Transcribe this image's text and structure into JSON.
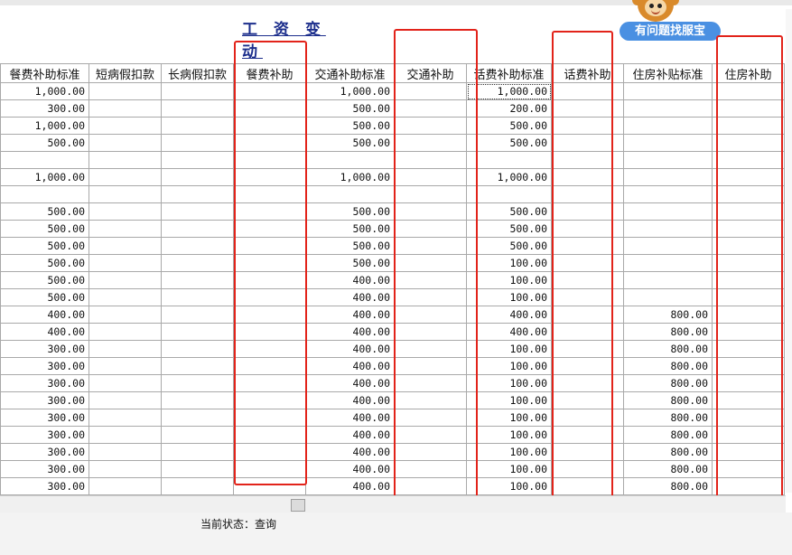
{
  "title": "工 资 变 动",
  "help_button": "有问题找服宝",
  "colors": {
    "title": "#1c2e8c",
    "highlight": "#e2231a",
    "help": "#4a90e2"
  },
  "columns": [
    "餐费补助标准",
    "短病假扣款",
    "长病假扣款",
    "餐费补助",
    "交通补助标准",
    "交通补助",
    "话费补助标准",
    "话费补助",
    "住房补贴标准",
    "住房补助"
  ],
  "rows": [
    [
      "1,000.00",
      "",
      "",
      "",
      "1,000.00",
      "",
      "1,000.00",
      "",
      "",
      ""
    ],
    [
      "300.00",
      "",
      "",
      "",
      "500.00",
      "",
      "200.00",
      "",
      "",
      ""
    ],
    [
      "1,000.00",
      "",
      "",
      "",
      "500.00",
      "",
      "500.00",
      "",
      "",
      ""
    ],
    [
      "500.00",
      "",
      "",
      "",
      "500.00",
      "",
      "500.00",
      "",
      "",
      ""
    ],
    [
      "",
      "",
      "",
      "",
      "",
      "",
      "",
      "",
      "",
      ""
    ],
    [
      "1,000.00",
      "",
      "",
      "",
      "1,000.00",
      "",
      "1,000.00",
      "",
      "",
      ""
    ],
    [
      "",
      "",
      "",
      "",
      "",
      "",
      "",
      "",
      "",
      ""
    ],
    [
      "500.00",
      "",
      "",
      "",
      "500.00",
      "",
      "500.00",
      "",
      "",
      ""
    ],
    [
      "500.00",
      "",
      "",
      "",
      "500.00",
      "",
      "500.00",
      "",
      "",
      ""
    ],
    [
      "500.00",
      "",
      "",
      "",
      "500.00",
      "",
      "500.00",
      "",
      "",
      ""
    ],
    [
      "500.00",
      "",
      "",
      "",
      "500.00",
      "",
      "100.00",
      "",
      "",
      ""
    ],
    [
      "500.00",
      "",
      "",
      "",
      "400.00",
      "",
      "100.00",
      "",
      "",
      ""
    ],
    [
      "500.00",
      "",
      "",
      "",
      "400.00",
      "",
      "100.00",
      "",
      "",
      ""
    ],
    [
      "400.00",
      "",
      "",
      "",
      "400.00",
      "",
      "400.00",
      "",
      "800.00",
      ""
    ],
    [
      "400.00",
      "",
      "",
      "",
      "400.00",
      "",
      "400.00",
      "",
      "800.00",
      ""
    ],
    [
      "300.00",
      "",
      "",
      "",
      "400.00",
      "",
      "100.00",
      "",
      "800.00",
      ""
    ],
    [
      "300.00",
      "",
      "",
      "",
      "400.00",
      "",
      "100.00",
      "",
      "800.00",
      ""
    ],
    [
      "300.00",
      "",
      "",
      "",
      "400.00",
      "",
      "100.00",
      "",
      "800.00",
      ""
    ],
    [
      "300.00",
      "",
      "",
      "",
      "400.00",
      "",
      "100.00",
      "",
      "800.00",
      ""
    ],
    [
      "300.00",
      "",
      "",
      "",
      "400.00",
      "",
      "100.00",
      "",
      "800.00",
      ""
    ],
    [
      "300.00",
      "",
      "",
      "",
      "400.00",
      "",
      "100.00",
      "",
      "800.00",
      ""
    ],
    [
      "300.00",
      "",
      "",
      "",
      "400.00",
      "",
      "100.00",
      "",
      "800.00",
      ""
    ],
    [
      "300.00",
      "",
      "",
      "",
      "400.00",
      "",
      "100.00",
      "",
      "800.00",
      ""
    ],
    [
      "300.00",
      "",
      "",
      "",
      "400.00",
      "",
      "100.00",
      "",
      "800.00",
      ""
    ]
  ],
  "status": "当前状态：查询"
}
